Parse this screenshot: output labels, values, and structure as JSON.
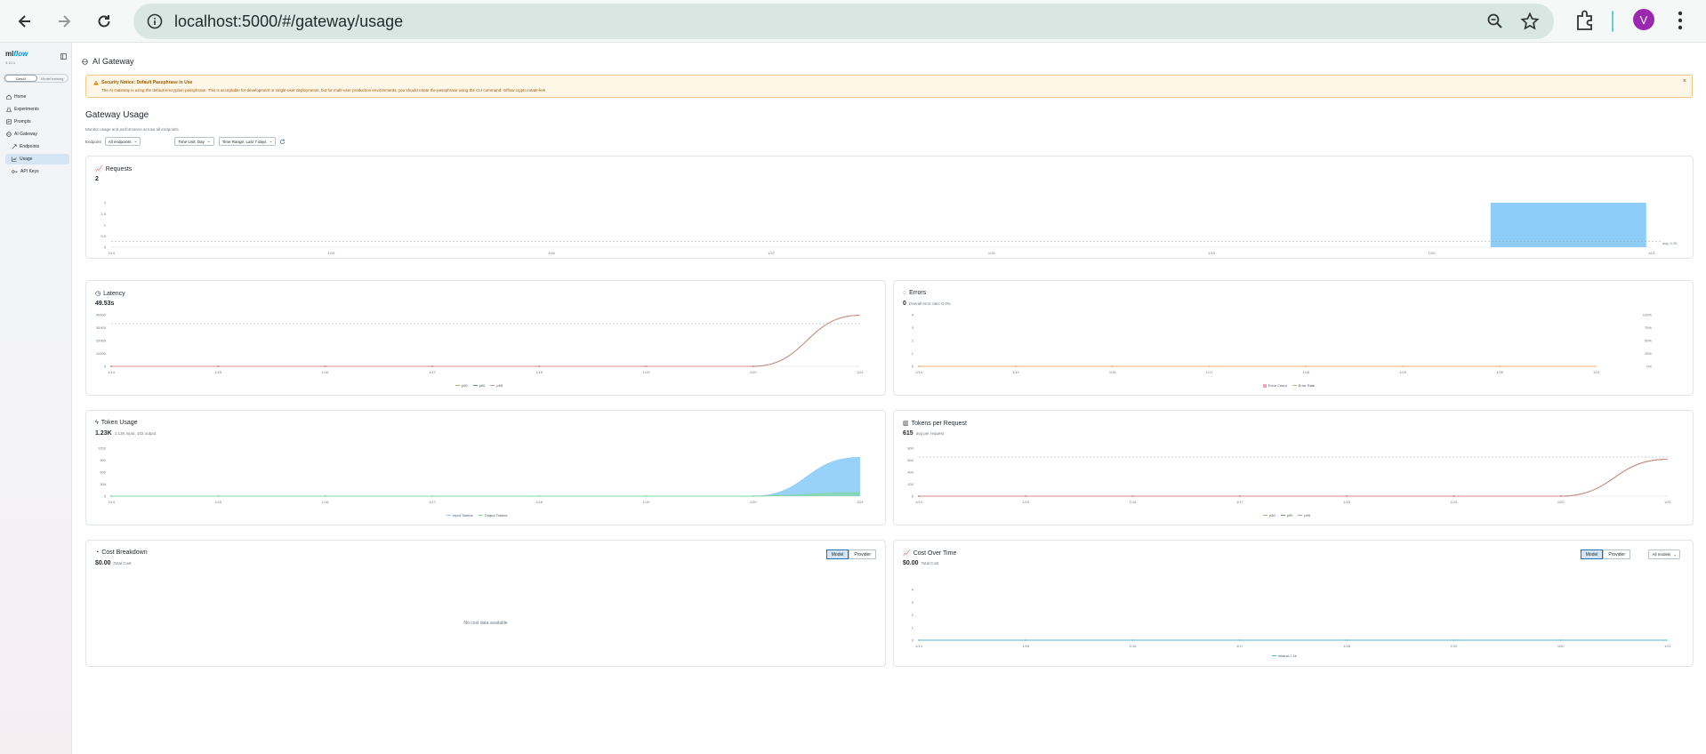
{
  "browser": {
    "url": "localhost:5000/#/gateway/usage",
    "avatar_letter": "V"
  },
  "sidebar": {
    "logo_ml": "ml",
    "logo_flow": "flow",
    "version": "3.10.1",
    "modes": [
      "GenAI",
      "Model training"
    ],
    "items": [
      {
        "label": "Home",
        "icon": "home-icon"
      },
      {
        "label": "Experiments",
        "icon": "beaker-icon"
      },
      {
        "label": "Prompts",
        "icon": "prompt-icon"
      },
      {
        "label": "AI Gateway",
        "icon": "gateway-icon"
      },
      {
        "label": "Endpoints",
        "icon": "endpoint-icon"
      },
      {
        "label": "Usage",
        "icon": "chart-icon"
      },
      {
        "label": "API Keys",
        "icon": "key-icon"
      }
    ]
  },
  "page": {
    "header": "AI Gateway",
    "banner_title": "Security Notice: Default Passphrase in Use",
    "banner_text": "The AI Gateway is using the default encryption passphrase. This is acceptable for development or single-user deployments, but for multi-user production environments, you should rotate the passphrase using the CLI command: mlflow crypto rotate-kek",
    "title": "Gateway Usage",
    "subtitle": "Monitor usage and performance across all endpoints",
    "filter_endpoint_label": "Endpoint",
    "filter_endpoint_value": "All endpoints",
    "filter_time_unit": "Time Unit: Day",
    "filter_time_range": "Time Range: Last 7 days"
  },
  "cards": {
    "requests": {
      "title": "Requests",
      "value": "2"
    },
    "latency": {
      "title": "Latency",
      "value": "49.53s",
      "legend": [
        "p50",
        "p90",
        "p99"
      ]
    },
    "errors": {
      "title": "Errors",
      "value": "0",
      "sub": "Overall error rate: 0.0%",
      "legend": [
        "Error Count",
        "Error Rate"
      ]
    },
    "tokens": {
      "title": "Token Usage",
      "value": "1.23K",
      "sub": "1.13K input, 102 output",
      "legend": [
        "Input Tokens",
        "Output Tokens"
      ]
    },
    "tpr": {
      "title": "Tokens per Request",
      "value": "615",
      "sub": "avg per request",
      "legend": [
        "p50",
        "p90",
        "p99"
      ]
    },
    "cost_breakdown": {
      "title": "Cost Breakdown",
      "value": "$0.00",
      "sub": "Total Cost",
      "seg": [
        "Model",
        "Provider"
      ],
      "empty": "No cost data available"
    },
    "cost_time": {
      "title": "Cost Over Time",
      "value": "$0.00",
      "sub": "Total Cost",
      "seg": [
        "Model",
        "Provider"
      ],
      "select": "All models",
      "legend": [
        "mistral-7.1b"
      ]
    }
  },
  "colors": {
    "accent": "#2272b4",
    "bar": "#8ecdf8",
    "token_area": "#8ecdf8",
    "p50": "#c5a46d",
    "p90": "#5aa05a",
    "p99": "#d98a8a",
    "error_count": "#f0a0c0",
    "error_rate": "#f0b070",
    "cost_line": "#56b6d6"
  },
  "chart_data": [
    {
      "type": "bar",
      "title": "Requests",
      "categories": [
        "1/14",
        "1/15",
        "1/16",
        "1/17",
        "1/18",
        "1/19",
        "1/20",
        "1/21"
      ],
      "values": [
        0,
        0,
        0,
        0,
        0,
        0,
        0,
        2
      ],
      "ylim": [
        0,
        2
      ],
      "yticks": [
        "0",
        "0.5",
        "1",
        "1.5",
        "2"
      ],
      "reference_label": "avg: 0.25"
    },
    {
      "type": "line",
      "title": "Latency",
      "x": [
        "1/14",
        "1/15",
        "1/16",
        "1/17",
        "1/18",
        "1/19",
        "1/20",
        "1/21"
      ],
      "series": [
        {
          "name": "p50",
          "values": [
            0,
            0,
            0,
            0,
            0,
            0,
            0,
            49530
          ]
        },
        {
          "name": "p90",
          "values": [
            0,
            0,
            0,
            0,
            0,
            0,
            0,
            49530
          ]
        },
        {
          "name": "p99",
          "values": [
            0,
            0,
            0,
            0,
            0,
            0,
            0,
            49530
          ]
        }
      ],
      "yticks": [
        "0",
        "10000",
        "20000",
        "30000",
        "40000"
      ],
      "ylim": [
        0,
        50000
      ]
    },
    {
      "type": "line",
      "title": "Errors",
      "x": [
        "1/14",
        "1/15",
        "1/16",
        "1/17",
        "1/18",
        "1/19",
        "1/20",
        "1/21"
      ],
      "series": [
        {
          "name": "Error Count",
          "values": [
            0,
            0,
            0,
            0,
            0,
            0,
            0,
            0
          ]
        },
        {
          "name": "Error Rate",
          "values": [
            0,
            0,
            0,
            0,
            0,
            0,
            0,
            0
          ]
        }
      ],
      "yticks": [
        "0",
        "1",
        "2",
        "3",
        "4"
      ],
      "y2ticks": [
        "0%",
        "25%",
        "50%",
        "75%",
        "100%"
      ]
    },
    {
      "type": "area",
      "title": "Token Usage",
      "x": [
        "1/14",
        "1/15",
        "1/16",
        "1/17",
        "1/18",
        "1/19",
        "1/20",
        "1/21"
      ],
      "series": [
        {
          "name": "Input Tokens",
          "values": [
            0,
            0,
            0,
            0,
            0,
            0,
            0,
            1130
          ]
        },
        {
          "name": "Output Tokens",
          "values": [
            0,
            0,
            0,
            0,
            0,
            0,
            0,
            102
          ]
        }
      ],
      "yticks": [
        "0",
        "300",
        "600",
        "900",
        "1200"
      ],
      "ylim": [
        0,
        1400
      ]
    },
    {
      "type": "line",
      "title": "Tokens per Request",
      "x": [
        "1/14",
        "1/15",
        "1/16",
        "1/17",
        "1/18",
        "1/19",
        "1/20",
        "1/21"
      ],
      "series": [
        {
          "name": "p50",
          "values": [
            0,
            0,
            0,
            0,
            0,
            0,
            0,
            615
          ]
        },
        {
          "name": "p90",
          "values": [
            0,
            0,
            0,
            0,
            0,
            0,
            0,
            615
          ]
        },
        {
          "name": "p99",
          "values": [
            0,
            0,
            0,
            0,
            0,
            0,
            0,
            615
          ]
        }
      ],
      "yticks": [
        "0",
        "200",
        "400",
        "600",
        "800"
      ],
      "ylim": [
        0,
        800
      ]
    },
    {
      "type": "line",
      "title": "Cost Over Time",
      "x": [
        "1/14",
        "1/15",
        "1/16",
        "1/17",
        "1/18",
        "1/19",
        "1/20",
        "1/21"
      ],
      "series": [
        {
          "name": "mistral-7.1b",
          "values": [
            0,
            0,
            0,
            0,
            0,
            0,
            0,
            0
          ]
        }
      ],
      "yticks": [
        "0",
        "1",
        "2",
        "3",
        "4"
      ]
    }
  ]
}
